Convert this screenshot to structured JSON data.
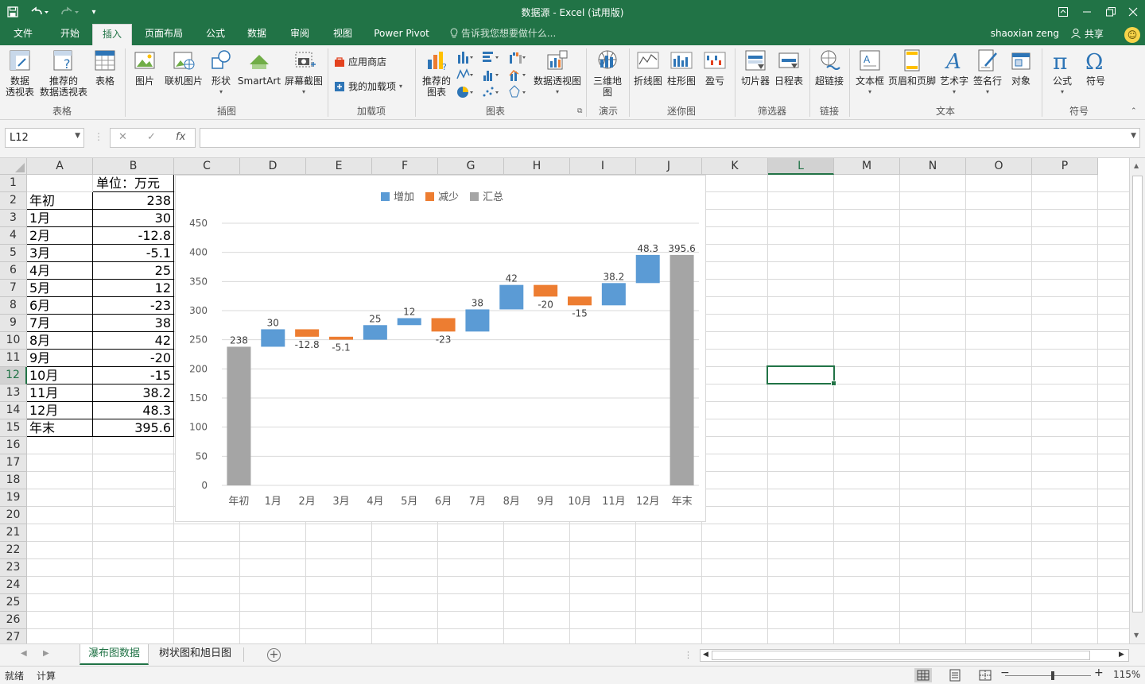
{
  "window": {
    "title": "数据源 - Excel (试用版)",
    "undo_icon": "undo-icon",
    "redo_icon": "redo-icon",
    "save_icon": "save-icon",
    "customize_icon": "customize-quick-access-icon"
  },
  "tabs": [
    "文件",
    "开始",
    "插入",
    "页面布局",
    "公式",
    "数据",
    "审阅",
    "视图",
    "Power Pivot"
  ],
  "active_tab": "插入",
  "tell_me": "告诉我您想要做什么...",
  "user": "shaoxian zeng",
  "share": "共享",
  "ribbon": {
    "tables": {
      "pivot": "数据\n透视表",
      "recommended_pivot": "推荐的\n数据透视表",
      "table": "表格",
      "group": "表格"
    },
    "illustrations": {
      "picture": "图片",
      "online_picture": "联机图片",
      "shapes": "形状",
      "smartart": "SmartArt",
      "screenshot": "屏幕截图",
      "group": "插图"
    },
    "addins": {
      "store": "应用商店",
      "my_addins": "我的加载项",
      "group": "加载项"
    },
    "charts": {
      "recommended": "推荐的\n图表",
      "pivotchart": "数据透视图",
      "group": "图表"
    },
    "tours": {
      "map3d": "三维地\n图",
      "group": "演示"
    },
    "sparklines": {
      "line": "折线图",
      "column": "柱形图",
      "winloss": "盈亏",
      "group": "迷你图"
    },
    "filters": {
      "slicer": "切片器",
      "timeline": "日程表",
      "group": "筛选器"
    },
    "links": {
      "hyperlink": "超链接",
      "group": "链接"
    },
    "text": {
      "textbox": "文本框",
      "header_footer": "页眉和页脚",
      "wordart": "艺术字",
      "signature": "签名行",
      "object": "对象",
      "group": "文本"
    },
    "symbols": {
      "equation": "公式",
      "symbol": "符号",
      "group": "符号"
    }
  },
  "formula_bar": {
    "name_box": "L12",
    "cancel": "✕",
    "enter": "✓",
    "fx": "fx",
    "formula": ""
  },
  "columns": [
    "A",
    "B",
    "C",
    "D",
    "E",
    "F",
    "G",
    "H",
    "I",
    "J",
    "K",
    "L",
    "M",
    "N",
    "O",
    "P"
  ],
  "rows": [
    "1",
    "2",
    "3",
    "4",
    "5",
    "6",
    "7",
    "8",
    "9",
    "10",
    "11",
    "12",
    "13",
    "14",
    "15",
    "16",
    "17",
    "18",
    "19",
    "20",
    "21",
    "22",
    "23",
    "24",
    "25",
    "26",
    "27"
  ],
  "selected_cell": {
    "column": "L",
    "row": "12"
  },
  "table": {
    "unit_header": "单位：万元",
    "labels": [
      "年初",
      "1月",
      "2月",
      "3月",
      "4月",
      "5月",
      "6月",
      "7月",
      "8月",
      "9月",
      "10月",
      "11月",
      "12月",
      "年末"
    ],
    "values": [
      "238",
      "30",
      "-12.8",
      "-5.1",
      "25",
      "12",
      "-23",
      "38",
      "42",
      "-20",
      "-15",
      "38.2",
      "48.3",
      "395.6"
    ]
  },
  "chart_data": {
    "type": "waterfall",
    "categories": [
      "年初",
      "1月",
      "2月",
      "3月",
      "4月",
      "5月",
      "6月",
      "7月",
      "8月",
      "9月",
      "10月",
      "11月",
      "12月",
      "年末"
    ],
    "values": [
      238,
      30,
      -12.8,
      -5.1,
      25,
      12,
      -23,
      38,
      42,
      -20,
      -15,
      38.2,
      48.3,
      395.6
    ],
    "data_labels": [
      "238",
      "30",
      "-12.8",
      "-5.1",
      "25",
      "12",
      "-23",
      "38",
      "42",
      "-20",
      "-15",
      "38.2",
      "48.3",
      "395.6"
    ],
    "kinds": [
      "total",
      "increase",
      "decrease",
      "decrease",
      "increase",
      "increase",
      "decrease",
      "increase",
      "increase",
      "decrease",
      "decrease",
      "increase",
      "increase",
      "total"
    ],
    "legend": [
      {
        "name": "增加",
        "color": "#5b9bd5"
      },
      {
        "name": "减少",
        "color": "#ed7d31"
      },
      {
        "name": "汇总",
        "color": "#a5a5a5"
      }
    ],
    "legend_position": "top",
    "ylim": [
      0,
      450
    ],
    "yticks": [
      0,
      50,
      100,
      150,
      200,
      250,
      300,
      350,
      400,
      450
    ],
    "grid": true,
    "title": "",
    "xlabel": "",
    "ylabel": ""
  },
  "sheets": [
    "瀑布图数据",
    "树状图和旭日图"
  ],
  "active_sheet": "瀑布图数据",
  "status": {
    "ready": "就绪",
    "calc": "计算",
    "zoom": "115%"
  },
  "colors": {
    "accent": "#217346",
    "increase": "#5b9bd5",
    "decrease": "#ed7d31",
    "total": "#a5a5a5"
  }
}
